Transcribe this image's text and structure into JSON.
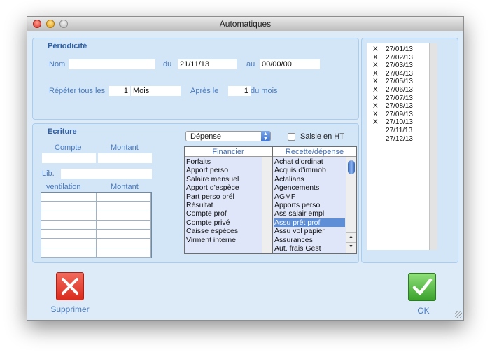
{
  "window": {
    "title": "Automatiques"
  },
  "periodicite": {
    "title": "Périodicité",
    "nom_label": "Nom",
    "nom_value": "",
    "du_label": "du",
    "du_value": "21/11/13",
    "au_label": "au",
    "au_value": "00/00/00",
    "repeter_label": "Répéter tous les",
    "repeter_value": "1",
    "unit_value": "Mois",
    "apres_label": "Après le",
    "apres_value": "1",
    "du_mois_label": "du mois"
  },
  "ecriture": {
    "title": "Ecriture",
    "compte_label": "Compte",
    "montant_label": "Montant",
    "lib_label": "Lib.",
    "ventilation_label": "ventilation",
    "montant2_label": "Montant",
    "type_select": "Dépense",
    "saisie_ht_label": "Saisie en HT",
    "saisie_ht_checked": false
  },
  "financier": {
    "header": "Financier",
    "items": [
      "Forfaits",
      "Apport perso",
      "Salaire mensuel",
      "Apport d'espèce",
      "Part perso prél",
      "Résultat",
      "Compte prof",
      "Compte privé",
      "Caisse espèces",
      "Virment interne"
    ]
  },
  "recette": {
    "header": "Recette/dépense",
    "items": [
      "Achat d'ordinat",
      "Acquis d'immob",
      "Actalians",
      "Agencements",
      "AGMF",
      "Apports perso",
      "Ass salair empl",
      "Assu prêt prof",
      "Assu vol papier",
      "Assurances",
      "Aut. frais Gest"
    ],
    "selected_index": 7
  },
  "dates": [
    {
      "mark": "X",
      "date": "27/01/13"
    },
    {
      "mark": "X",
      "date": "27/02/13"
    },
    {
      "mark": "X",
      "date": "27/03/13"
    },
    {
      "mark": "X",
      "date": "27/04/13"
    },
    {
      "mark": "X",
      "date": "27/05/13"
    },
    {
      "mark": "X",
      "date": "27/06/13"
    },
    {
      "mark": "X",
      "date": "27/07/13"
    },
    {
      "mark": "X",
      "date": "27/08/13"
    },
    {
      "mark": "X",
      "date": "27/09/13"
    },
    {
      "mark": "X",
      "date": "27/10/13"
    },
    {
      "mark": "",
      "date": "27/11/13"
    },
    {
      "mark": "",
      "date": "27/12/13"
    }
  ],
  "buttons": {
    "supprimer": "Supprimer",
    "ok": "OK"
  },
  "colors": {
    "window_bg": "#dcebf7",
    "panel_bg": "#d2e6f8",
    "label_blue": "#4a7ac0",
    "selection": "#5e8ed6",
    "delete_red": "#e53b2c",
    "ok_green": "#3aa12c"
  }
}
